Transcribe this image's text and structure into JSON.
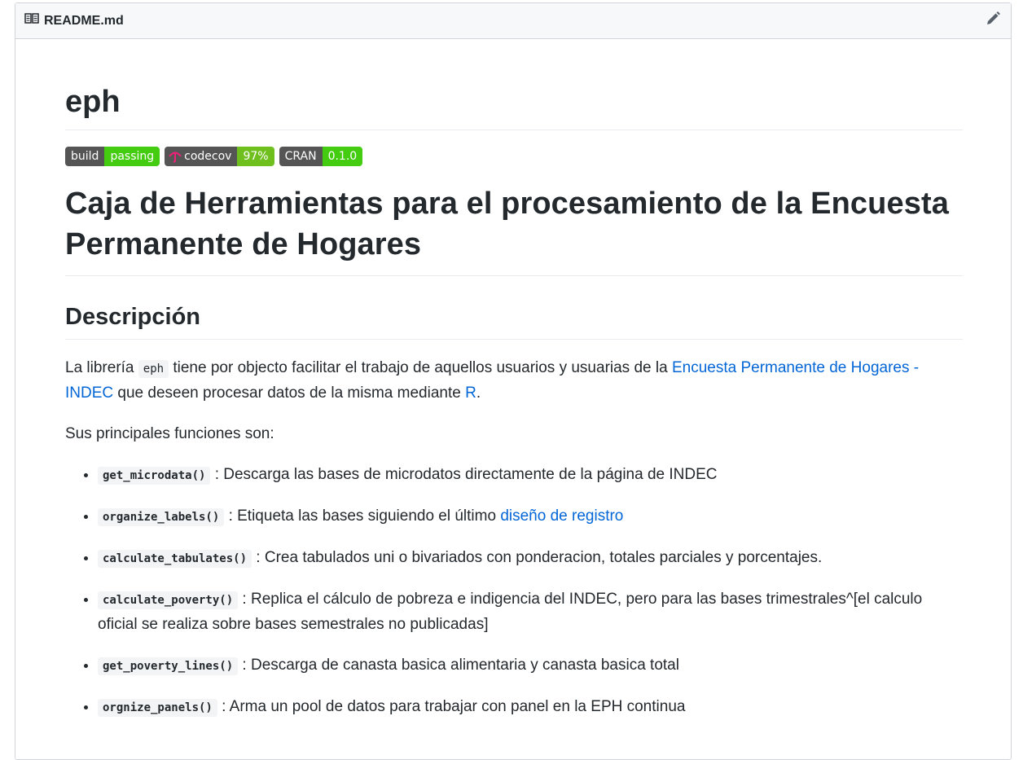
{
  "header": {
    "file_name": "README.md",
    "file_icon": "book-icon",
    "edit_icon": "pencil-icon"
  },
  "content": {
    "title": "eph",
    "badges": [
      {
        "label": "build",
        "value": "passing"
      },
      {
        "label": "codecov",
        "value": "97%",
        "icon": "umbrella-icon"
      },
      {
        "label": "CRAN",
        "value": "0.1.0"
      }
    ],
    "heading": "Caja de Herramientas para el procesamiento de la Encuesta Permanente de Hogares",
    "section_heading": "Descripción",
    "intro": {
      "t1": "La librería ",
      "code": "eph",
      "t2": " tiene por objecto facilitar el trabajo de aquellos usuarios y usuarias de la ",
      "link1": "Encuesta Permanente de Hogares - INDEC",
      "t3": " que deseen procesar datos de la misma mediante ",
      "link2": "R",
      "t4": "."
    },
    "functions_intro": "Sus principales funciones son:",
    "functions": [
      {
        "code": "get_microdata()",
        "text": " : Descarga las bases de microdatos directamente de la página de INDEC"
      },
      {
        "code": "organize_labels()",
        "text": " : Etiqueta las bases siguiendo el último ",
        "link": "diseño de registro"
      },
      {
        "code": "calculate_tabulates()",
        "text": " : Crea tabulados uni o bivariados con ponderacion, totales parciales y porcentajes."
      },
      {
        "code": "calculate_poverty()",
        "text": " : Replica el cálculo de pobreza e indigencia del INDEC, pero para las bases trimestrales^[el calculo oficial se realiza sobre bases semestrales no publicadas]"
      },
      {
        "code": "get_poverty_lines()",
        "text": " : Descarga de canasta basica alimentaria y canasta basica total"
      },
      {
        "code": "orgnize_panels()",
        "text": " : Arma un pool de datos para trabajar con panel en la EPH continua"
      }
    ]
  },
  "colors": {
    "link": "#0366d6",
    "badge_label": "#555555",
    "badge_ok": "#44cc11",
    "codecov_icon": "#f01f7a"
  }
}
